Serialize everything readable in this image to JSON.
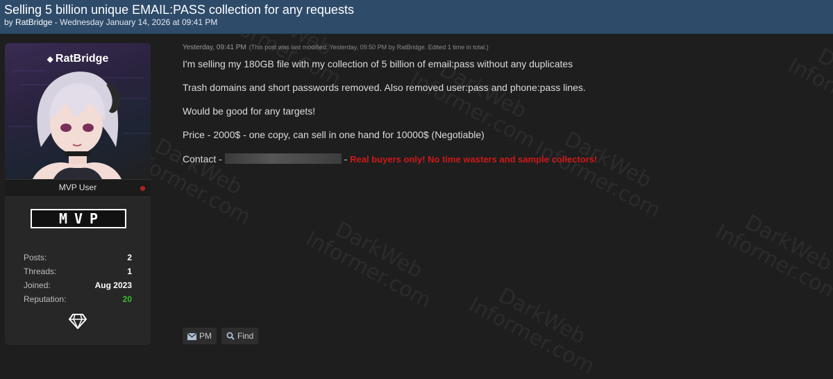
{
  "thread": {
    "title": "Selling 5 billion unique EMAIL:PASS collection for any requests",
    "by": "by",
    "author": "RatBridge",
    "date": "- Wednesday January 14, 2026 at 09:41 PM"
  },
  "user": {
    "name": "RatBridge",
    "title": "MVP User",
    "badge": "MVP",
    "stats": [
      {
        "label": "Posts:",
        "value": "2"
      },
      {
        "label": "Threads:",
        "value": "1"
      },
      {
        "label": "Joined:",
        "value": "Aug 2023"
      },
      {
        "label": "Reputation:",
        "value": "20"
      }
    ]
  },
  "post": {
    "date": "Yesterday, 09:41 PM",
    "edit_note": "(This post was last modified: Yesterday, 09:50 PM by RatBridge. Edited 1 time in total.)",
    "lines": [
      "I'm selling my 180GB file with my collection of 5 billion of email:pass without any duplicates",
      "Trash domains and short passwords removed. Also removed user:pass and phone:pass lines.",
      "Would be good for any targets!",
      "Price - 2000$ - one copy, can sell in one hand for 10000$ (Negotiable)"
    ],
    "contact_prefix": "Contact -",
    "contact_sep": "-",
    "warning": "Real buyers only! No time wasters and sample collectors!"
  },
  "buttons": {
    "pm": "PM",
    "find": "Find"
  },
  "watermark": {
    "line1": "DarkWeb",
    "line2": "Informer.com"
  },
  "colors": {
    "header": "#2e4b6a",
    "background": "#1e1e1e",
    "warning": "#d01818",
    "reputation": "#3cba2d"
  }
}
